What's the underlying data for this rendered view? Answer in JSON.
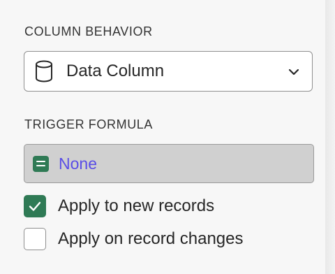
{
  "column_behavior": {
    "title": "COLUMN BEHAVIOR",
    "selected": {
      "icon": "database-icon",
      "label": "Data Column"
    }
  },
  "trigger_formula": {
    "title": "TRIGGER FORMULA",
    "icon": "formula-icon",
    "value": "None"
  },
  "options": [
    {
      "label": "Apply to new records",
      "checked": true
    },
    {
      "label": "Apply on record changes",
      "checked": false
    }
  ],
  "colors": {
    "accent_green": "#2f7a55",
    "formula_text": "#5a4ee6",
    "formula_bg": "#d0d0d0",
    "panel_bg": "#f7f7f7"
  }
}
